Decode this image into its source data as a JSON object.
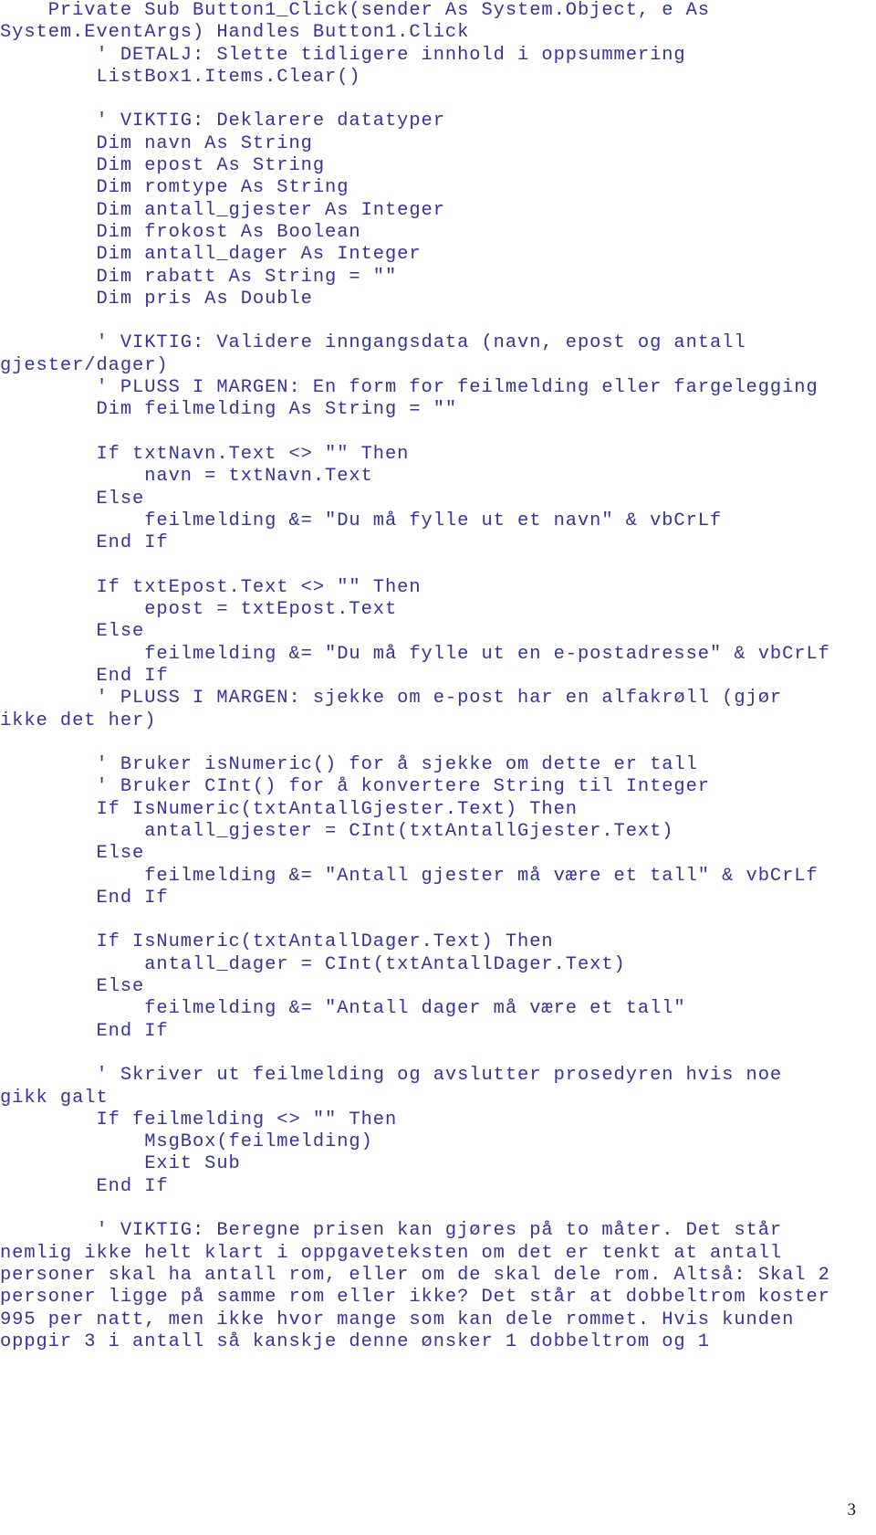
{
  "document": {
    "language": "vbnet",
    "page_number": "3",
    "text_color": "#333399",
    "background_color": "#ffffff",
    "page_number_color": "#111111"
  },
  "code": {
    "lines": [
      "    Private Sub Button1_Click(sender As System.Object, e As",
      "System.EventArgs) Handles Button1.Click",
      "        ' DETALJ: Slette tidligere innhold i oppsummering",
      "        ListBox1.Items.Clear()",
      "",
      "        ' VIKTIG: Deklarere datatyper",
      "        Dim navn As String",
      "        Dim epost As String",
      "        Dim romtype As String",
      "        Dim antall_gjester As Integer",
      "        Dim frokost As Boolean",
      "        Dim antall_dager As Integer",
      "        Dim rabatt As String = \"\"",
      "        Dim pris As Double",
      "",
      "        ' VIKTIG: Validere inngangsdata (navn, epost og antall",
      "gjester/dager)",
      "        ' PLUSS I MARGEN: En form for feilmelding eller fargelegging",
      "        Dim feilmelding As String = \"\"",
      "",
      "        If txtNavn.Text <> \"\" Then",
      "            navn = txtNavn.Text",
      "        Else",
      "            feilmelding &= \"Du må fylle ut et navn\" & vbCrLf",
      "        End If",
      "",
      "        If txtEpost.Text <> \"\" Then",
      "            epost = txtEpost.Text",
      "        Else",
      "            feilmelding &= \"Du må fylle ut en e-postadresse\" & vbCrLf",
      "        End If",
      "        ' PLUSS I MARGEN: sjekke om e-post har en alfakrøll (gjør",
      "ikke det her)",
      "",
      "        ' Bruker isNumeric() for å sjekke om dette er tall",
      "        ' Bruker CInt() for å konvertere String til Integer",
      "        If IsNumeric(txtAntallGjester.Text) Then",
      "            antall_gjester = CInt(txtAntallGjester.Text)",
      "        Else",
      "            feilmelding &= \"Antall gjester må være et tall\" & vbCrLf",
      "        End If",
      "",
      "        If IsNumeric(txtAntallDager.Text) Then",
      "            antall_dager = CInt(txtAntallDager.Text)",
      "        Else",
      "            feilmelding &= \"Antall dager må være et tall\"",
      "        End If",
      "",
      "        ' Skriver ut feilmelding og avslutter prosedyren hvis noe",
      "gikk galt",
      "        If feilmelding <> \"\" Then",
      "            MsgBox(feilmelding)",
      "            Exit Sub",
      "        End If",
      "",
      "        ' VIKTIG: Beregne prisen kan gjøres på to måter. Det står",
      "nemlig ikke helt klart i oppgaveteksten om det er tenkt at antall",
      "personer skal ha antall rom, eller om de skal dele rom. Altså: Skal 2",
      "personer ligge på samme rom eller ikke? Det står at dobbeltrom koster",
      "995 per natt, men ikke hvor mange som kan dele rommet. Hvis kunden",
      "oppgir 3 i antall så kanskje denne ønsker 1 dobbeltrom og 1"
    ]
  }
}
